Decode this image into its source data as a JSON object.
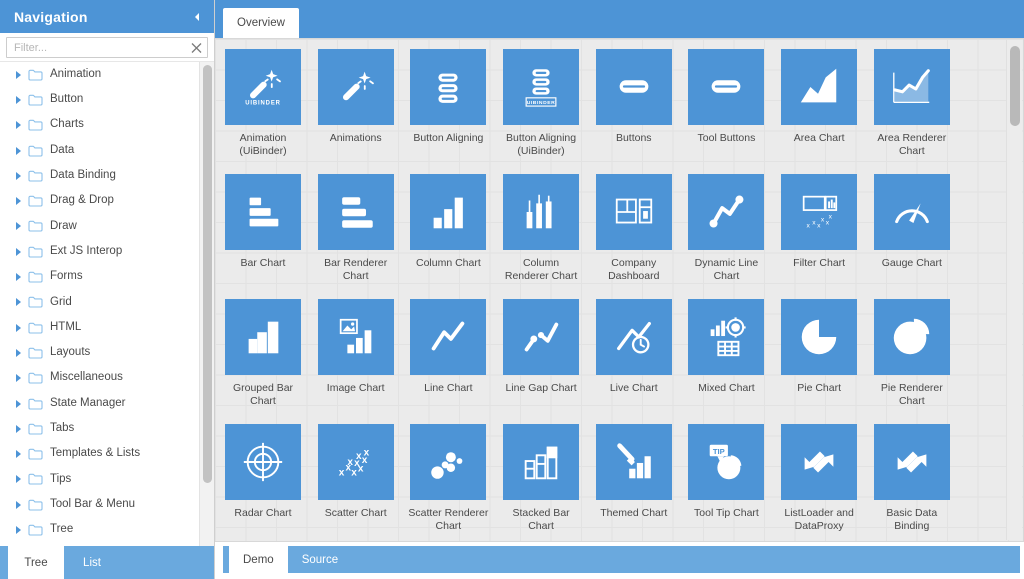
{
  "colors": {
    "brand_blue": "#4d94d6",
    "brand_blue_light": "#6aa9de",
    "canvas_gray": "#ebebeb",
    "grid_line": "#e2e2e2",
    "text": "#4a4a4a"
  },
  "sidebar": {
    "title": "Navigation",
    "collapse_icon": "chevron-left-icon",
    "filter": {
      "placeholder": "Filter...",
      "value": "",
      "clear_icon": "close-icon"
    },
    "items": [
      {
        "label": "Animation",
        "icon": "folder-icon",
        "expander": "chevron-right-icon"
      },
      {
        "label": "Button",
        "icon": "folder-icon",
        "expander": "chevron-right-icon"
      },
      {
        "label": "Charts",
        "icon": "folder-icon",
        "expander": "chevron-right-icon"
      },
      {
        "label": "Data",
        "icon": "folder-icon",
        "expander": "chevron-right-icon"
      },
      {
        "label": "Data Binding",
        "icon": "folder-icon",
        "expander": "chevron-right-icon"
      },
      {
        "label": "Drag & Drop",
        "icon": "folder-icon",
        "expander": "chevron-right-icon"
      },
      {
        "label": "Draw",
        "icon": "folder-icon",
        "expander": "chevron-right-icon"
      },
      {
        "label": "Ext JS Interop",
        "icon": "folder-icon",
        "expander": "chevron-right-icon"
      },
      {
        "label": "Forms",
        "icon": "folder-icon",
        "expander": "chevron-right-icon"
      },
      {
        "label": "Grid",
        "icon": "folder-icon",
        "expander": "chevron-right-icon"
      },
      {
        "label": "HTML",
        "icon": "folder-icon",
        "expander": "chevron-right-icon"
      },
      {
        "label": "Layouts",
        "icon": "folder-icon",
        "expander": "chevron-right-icon"
      },
      {
        "label": "Miscellaneous",
        "icon": "folder-icon",
        "expander": "chevron-right-icon"
      },
      {
        "label": "State Manager",
        "icon": "folder-icon",
        "expander": "chevron-right-icon"
      },
      {
        "label": "Tabs",
        "icon": "folder-icon",
        "expander": "chevron-right-icon"
      },
      {
        "label": "Templates & Lists",
        "icon": "folder-icon",
        "expander": "chevron-right-icon"
      },
      {
        "label": "Tips",
        "icon": "folder-icon",
        "expander": "chevron-right-icon"
      },
      {
        "label": "Tool Bar & Menu",
        "icon": "folder-icon",
        "expander": "chevron-right-icon"
      },
      {
        "label": "Tree",
        "icon": "folder-icon",
        "expander": "chevron-right-icon"
      }
    ],
    "footer_tabs": [
      {
        "label": "Tree",
        "active": true
      },
      {
        "label": "List",
        "active": false
      }
    ]
  },
  "main": {
    "tabs": [
      {
        "label": "Overview",
        "active": true
      }
    ],
    "bottom_tabs": [
      {
        "label": "Demo",
        "active": true
      },
      {
        "label": "Source",
        "active": false
      }
    ],
    "tiles": [
      {
        "label": "Animation (UiBinder)",
        "icon": "magic-wand-uibinder-icon"
      },
      {
        "label": "Animations",
        "icon": "magic-wand-icon"
      },
      {
        "label": "Button Aligning",
        "icon": "stacked-pills-icon"
      },
      {
        "label": "Button Aligning (UiBinder)",
        "icon": "stacked-pills-uibinder-icon"
      },
      {
        "label": "Buttons",
        "icon": "pill-button-icon"
      },
      {
        "label": "Tool Buttons",
        "icon": "pill-button-icon"
      },
      {
        "label": "Area Chart",
        "icon": "area-chart-icon"
      },
      {
        "label": "Area Renderer Chart",
        "icon": "area-renderer-chart-icon"
      },
      {
        "label": "Bar Chart",
        "icon": "bar-chart-icon"
      },
      {
        "label": "Bar Renderer Chart",
        "icon": "bar-renderer-chart-icon"
      },
      {
        "label": "Column Chart",
        "icon": "column-chart-icon"
      },
      {
        "label": "Column Renderer Chart",
        "icon": "column-renderer-chart-icon"
      },
      {
        "label": "Company Dashboard",
        "icon": "dashboard-icon"
      },
      {
        "label": "Dynamic Line Chart",
        "icon": "dynamic-line-chart-icon"
      },
      {
        "label": "Filter Chart",
        "icon": "filter-chart-icon"
      },
      {
        "label": "Gauge Chart",
        "icon": "gauge-chart-icon"
      },
      {
        "label": "Grouped Bar Chart",
        "icon": "grouped-bar-chart-icon"
      },
      {
        "label": "Image Chart",
        "icon": "image-chart-icon"
      },
      {
        "label": "Line Chart",
        "icon": "line-chart-icon"
      },
      {
        "label": "Line Gap Chart",
        "icon": "line-gap-chart-icon"
      },
      {
        "label": "Live Chart",
        "icon": "live-chart-icon"
      },
      {
        "label": "Mixed Chart",
        "icon": "mixed-chart-icon"
      },
      {
        "label": "Pie Chart",
        "icon": "pie-chart-icon"
      },
      {
        "label": "Pie Renderer Chart",
        "icon": "pie-renderer-chart-icon"
      },
      {
        "label": "Radar Chart",
        "icon": "radar-chart-icon"
      },
      {
        "label": "Scatter Chart",
        "icon": "scatter-chart-icon"
      },
      {
        "label": "Scatter Renderer Chart",
        "icon": "scatter-renderer-chart-icon"
      },
      {
        "label": "Stacked Bar Chart",
        "icon": "stacked-bar-chart-icon"
      },
      {
        "label": "Themed Chart",
        "icon": "themed-chart-icon"
      },
      {
        "label": "Tool Tip Chart",
        "icon": "tooltip-chart-icon"
      },
      {
        "label": "ListLoader and DataProxy",
        "icon": "data-arrows-icon"
      },
      {
        "label": "Basic Data Binding",
        "icon": "data-arrows-icon"
      }
    ],
    "tile_icon_text": {
      "uibinder": "UIBINDER",
      "tip": "TIP"
    }
  }
}
